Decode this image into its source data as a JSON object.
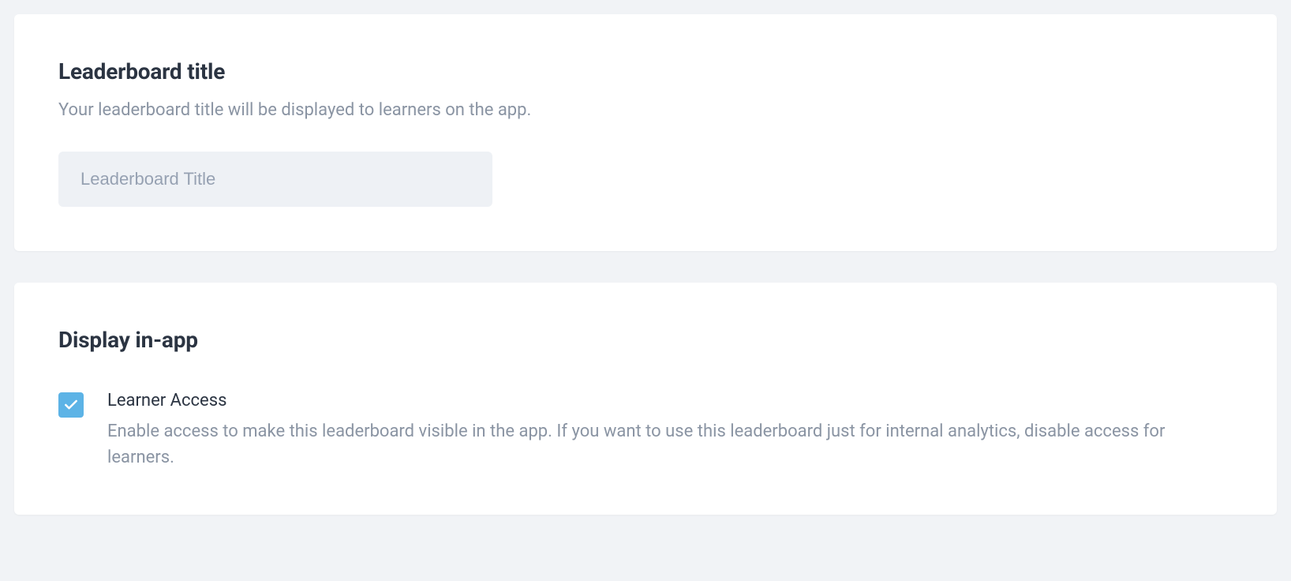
{
  "title_section": {
    "heading": "Leaderboard title",
    "subheading": "Your leaderboard title will be displayed to learners on the app.",
    "input_placeholder": "Leaderboard Title",
    "input_value": ""
  },
  "display_section": {
    "heading": "Display in-app",
    "checkbox": {
      "checked": true,
      "label": "Learner Access",
      "description": "Enable access to make this leaderboard visible in the app. If you want to use this leaderboard just for internal analytics, disable access for learners."
    }
  }
}
